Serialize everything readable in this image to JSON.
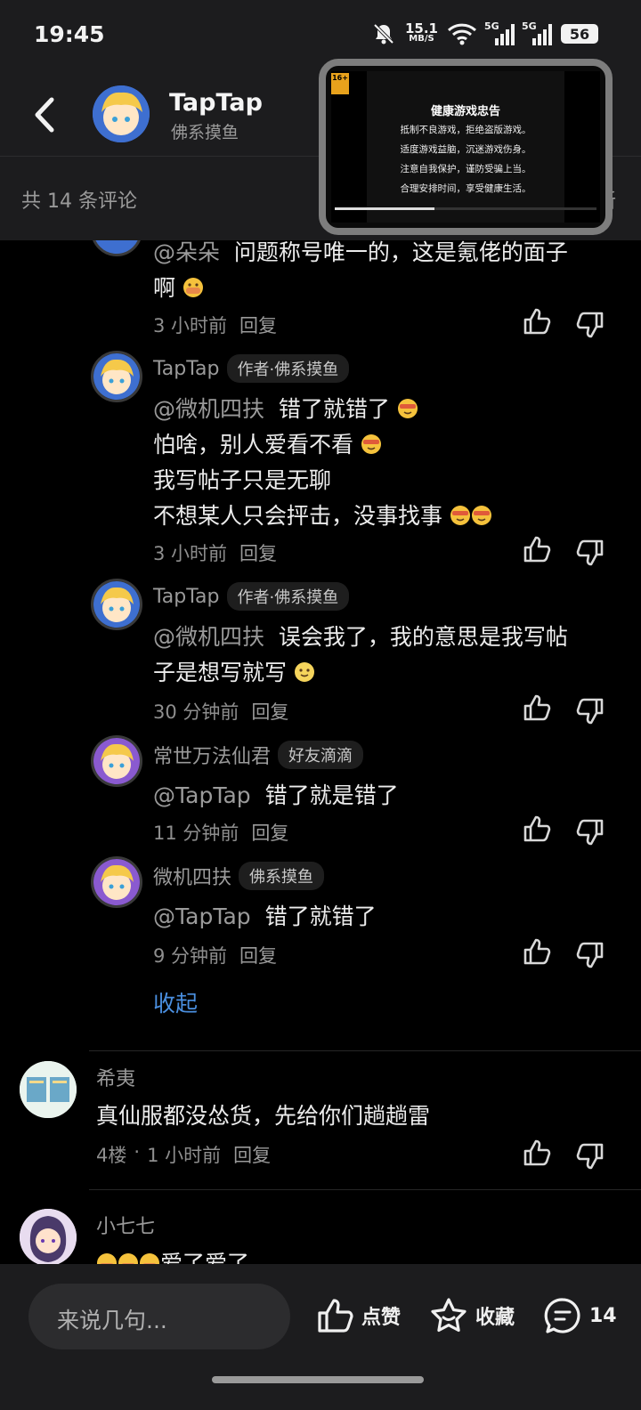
{
  "status_bar": {
    "time": "19:45",
    "net_speed": "15.1",
    "net_unit": "MB/S",
    "sig1": "5G",
    "sig2": "5G",
    "battery": "56"
  },
  "header": {
    "title": "TapTap",
    "subtitle": "佛系摸鱼"
  },
  "pip": {
    "age_badge": "16+",
    "title": "健康游戏忠告",
    "lines": [
      "抵制不良游戏，拒绝盗版游戏。",
      "适度游戏益脑，沉迷游戏伤身。",
      "注意自我保护，谨防受骗上当。",
      "合理安排时间，享受健康生活。"
    ]
  },
  "count_bar": {
    "count": "共 14 条评论",
    "sort": "新"
  },
  "comments": [
    {
      "mention": "@朵朵",
      "text1": "问题称号唯一的，这是氪佬的面子",
      "text2": "啊",
      "time": "3 小时前",
      "reply": "回复"
    },
    {
      "name": "TapTap",
      "badge": "作者·佛系摸鱼",
      "mention": "@微机四扶",
      "line1": "错了就错了",
      "line2": "怕啥，别人爱看不看",
      "line3": "我写帖子只是无聊",
      "line4": "不想某人只会抨击，没事找事",
      "time": "3 小时前",
      "reply": "回复"
    },
    {
      "name": "TapTap",
      "badge": "作者·佛系摸鱼",
      "mention": "@微机四扶",
      "line1": "误会我了，我的意思是我写帖",
      "line2": "子是想写就写",
      "time": "30 分钟前",
      "reply": "回复"
    },
    {
      "name": "常世万法仙君",
      "badge": "好友滴滴",
      "mention": "@TapTap",
      "line1": "错了就是错了",
      "time": "11 分钟前",
      "reply": "回复"
    },
    {
      "name": "微机四扶",
      "badge": "佛系摸鱼",
      "mention": "@TapTap",
      "line1": "错了就错了",
      "time": "9 分钟前",
      "reply": "回复"
    }
  ],
  "collapse": "收起",
  "floor_comments": [
    {
      "name": "希夷",
      "text": "真仙服都没怂货，先给你们趟趟雷",
      "floor": "4楼",
      "sep": "·",
      "time": "1 小时前",
      "reply": "回复"
    },
    {
      "name": "小七七",
      "text": "爱了爱了"
    }
  ],
  "bottom_bar": {
    "placeholder": "来说几句...",
    "like": "点赞",
    "fav": "收藏",
    "comments": "14"
  },
  "colors": {
    "link": "#4a8fe0",
    "background": "#000000",
    "panel": "#1c1c1e"
  }
}
